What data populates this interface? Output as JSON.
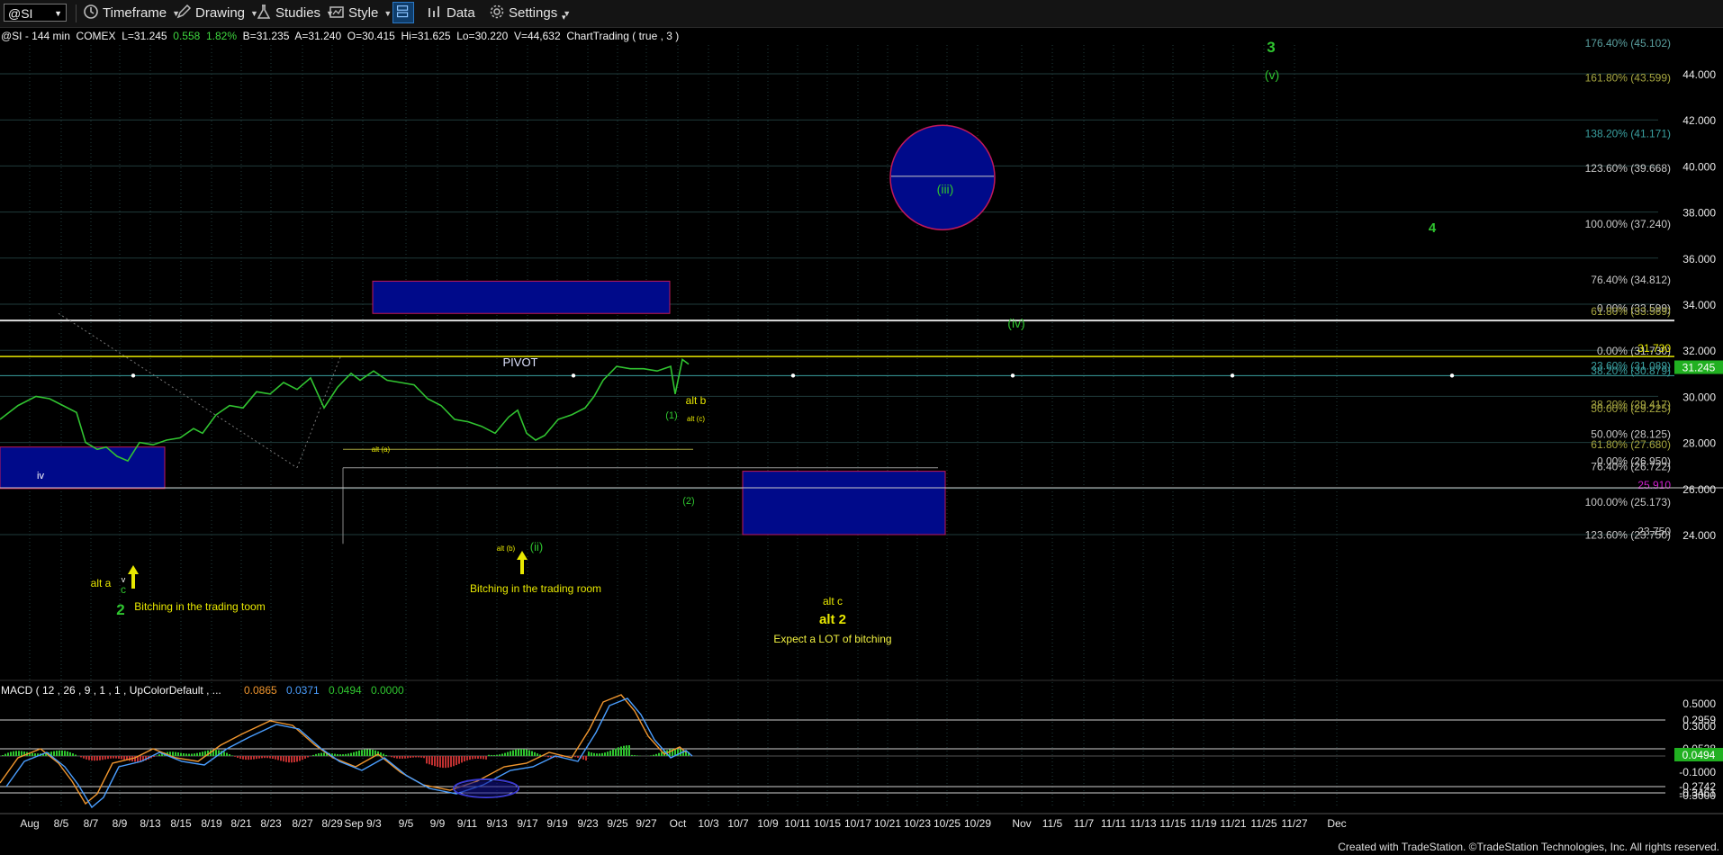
{
  "toolbar": {
    "symbol": "@SI",
    "items": [
      {
        "label": "Timeframe",
        "icon": "timeframe-icon"
      },
      {
        "label": "Drawing",
        "icon": "pencil-icon"
      },
      {
        "label": "Studies",
        "icon": "flask-icon"
      },
      {
        "label": "Style",
        "icon": "style-icon"
      },
      {
        "label": "Data",
        "icon": "bar-chart-icon"
      },
      {
        "label": "Settings",
        "icon": "gear-icon"
      }
    ]
  },
  "status_line": {
    "prefix": "@SI - 144 min  COMEX  L=31.245  ",
    "change": "0.558  1.82%",
    "rest": "  B=31.235  A=31.240  O=30.415  Hi=31.625  Lo=30.220  V=44,632  ChartTrading ( true , 3 )"
  },
  "colors": {
    "grid": "#1f3b3b",
    "price": "#31c431",
    "wave_green": "#2fc52f",
    "yellow": "#e8e800",
    "blue_box": "#000a8a",
    "magenta": "#d01fd0",
    "macd_blue": "#4a9eff",
    "macd_orange": "#f0962e"
  },
  "chart_data": {
    "type": "line",
    "price_axis": {
      "ticks": [
        "44.000",
        "42.000",
        "40.000",
        "38.000",
        "36.000",
        "34.000",
        "32.000",
        "30.000",
        "28.000",
        "26.000",
        "24.000"
      ],
      "last_price": "31.245"
    },
    "x_axis": {
      "ticks": [
        "Aug",
        "8/5",
        "8/7",
        "8/9",
        "8/13",
        "8/15",
        "8/19",
        "8/21",
        "8/23",
        "8/27",
        "8/29",
        "Sep 9/3",
        "9/5",
        "9/9",
        "9/11",
        "9/13",
        "9/17",
        "9/19",
        "9/23",
        "9/25",
        "9/27",
        "Oct",
        "10/3",
        "10/7",
        "10/9",
        "10/11",
        "10/15",
        "10/17",
        "10/21",
        "10/23",
        "10/25",
        "10/29",
        "Nov",
        "11/5",
        "11/7",
        "11/11",
        "11/13",
        "11/15",
        "11/19",
        "11/21",
        "11/25",
        "11/27",
        "Dec"
      ]
    },
    "fib_levels": [
      {
        "label": "176.40% (45.102)",
        "price": 45.102,
        "color": "#5aa0a0"
      },
      {
        "label": "161.80% (43.599)",
        "price": 43.599,
        "color": "#a6a640"
      },
      {
        "label": "138.20% (41.171)",
        "price": 41.171,
        "color": "#3aa0a0"
      },
      {
        "label": "123.60% (39.668)",
        "price": 39.668,
        "color": "#c8c8c8"
      },
      {
        "label": "100.00% (37.240)",
        "price": 37.24,
        "color": "#c8c8c8"
      },
      {
        "label": "76.40% (34.812)",
        "price": 34.812,
        "color": "#c8c8c8"
      },
      {
        "label": "0.00% (33.599)",
        "price": 33.599,
        "color": "#c8c8c8"
      },
      {
        "label": "61.80% (33.569)",
        "price": 33.45,
        "color": "#a6a640"
      },
      {
        "label": "0.00% (31.730)",
        "price": 31.73,
        "color": "#c8c8c8"
      },
      {
        "label": "31.730",
        "price": 31.85,
        "color": "#e8e800"
      },
      {
        "label": "23.60% (31.089)",
        "price": 31.089,
        "color": "#3aa0a0"
      },
      {
        "label": "38.20% (30.879)",
        "price": 30.879,
        "color": "#3aa0a0"
      },
      {
        "label": "38.20% (29.417)",
        "price": 29.417,
        "color": "#a6a640"
      },
      {
        "label": "50.00% (29.225)",
        "price": 29.225,
        "color": "#a6a640"
      },
      {
        "label": "50.00% (28.125)",
        "price": 28.125,
        "color": "#c8c8c8"
      },
      {
        "label": "61.80% (27.680)",
        "price": 27.68,
        "color": "#a6a640"
      },
      {
        "label": "0.00% (26.950)",
        "price": 26.95,
        "color": "#c8c8c8"
      },
      {
        "label": "76.40% (26.722)",
        "price": 26.722,
        "color": "#c8c8c8"
      },
      {
        "label": "25.910",
        "price": 25.91,
        "color": "#d01fd0"
      },
      {
        "label": "100.00% (25.173)",
        "price": 25.173,
        "color": "#c8c8c8"
      },
      {
        "label": "123.60% (23.750)",
        "price": 23.75,
        "color": "#c8c8c8"
      },
      {
        "label": "23.750",
        "price": 23.9,
        "color": "#c8c8c8"
      }
    ],
    "annotations": [
      {
        "text": "3",
        "kind": "wave-big"
      },
      {
        "text": "(v)",
        "kind": "wave"
      },
      {
        "text": "(iii)",
        "kind": "wave"
      },
      {
        "text": "4",
        "kind": "wave-big"
      },
      {
        "text": "(iv)",
        "kind": "wave"
      },
      {
        "text": "PIVOT",
        "kind": "box"
      },
      {
        "text": "alt b",
        "kind": "yellow"
      },
      {
        "text": "alt (c)",
        "kind": "yellow-small"
      },
      {
        "text": "(1)",
        "kind": "wave-small"
      },
      {
        "text": "(2)",
        "kind": "wave-small"
      },
      {
        "text": "alt (a)",
        "kind": "yellow-small"
      },
      {
        "text": "iv",
        "kind": "white-small"
      },
      {
        "text": "alt a",
        "kind": "yellow"
      },
      {
        "text": "c",
        "kind": "wave-small"
      },
      {
        "text": "v",
        "kind": "white-small"
      },
      {
        "text": "2",
        "kind": "wave-big"
      },
      {
        "text": "Bitching in the trading toom",
        "kind": "yellow"
      },
      {
        "text": "alt (b)",
        "kind": "yellow-small"
      },
      {
        "text": "(ii)",
        "kind": "wave"
      },
      {
        "text": "Bitching in the trading room",
        "kind": "yellow"
      },
      {
        "text": "alt c",
        "kind": "yellow"
      },
      {
        "text": "alt 2",
        "kind": "yellow-big"
      },
      {
        "text": "Expect a LOT of bitching",
        "kind": "yellow"
      }
    ],
    "macd": {
      "title": "MACD ( 12 , 26 , 9 , 1 , 1 , UpColorDefault , ...",
      "values": [
        "0.0865",
        "0.0371",
        "0.0494",
        "0.0000"
      ],
      "ticks": [
        "0.5000",
        "0.2959",
        "0.3000",
        "0.0528",
        "0.0494",
        "-0.1000",
        "-0.2742",
        "-0.3461",
        "-0.3000"
      ]
    }
  },
  "footer": {
    "credit": "Created with TradeStation. ©TradeStation Technologies, Inc. All rights reserved."
  }
}
